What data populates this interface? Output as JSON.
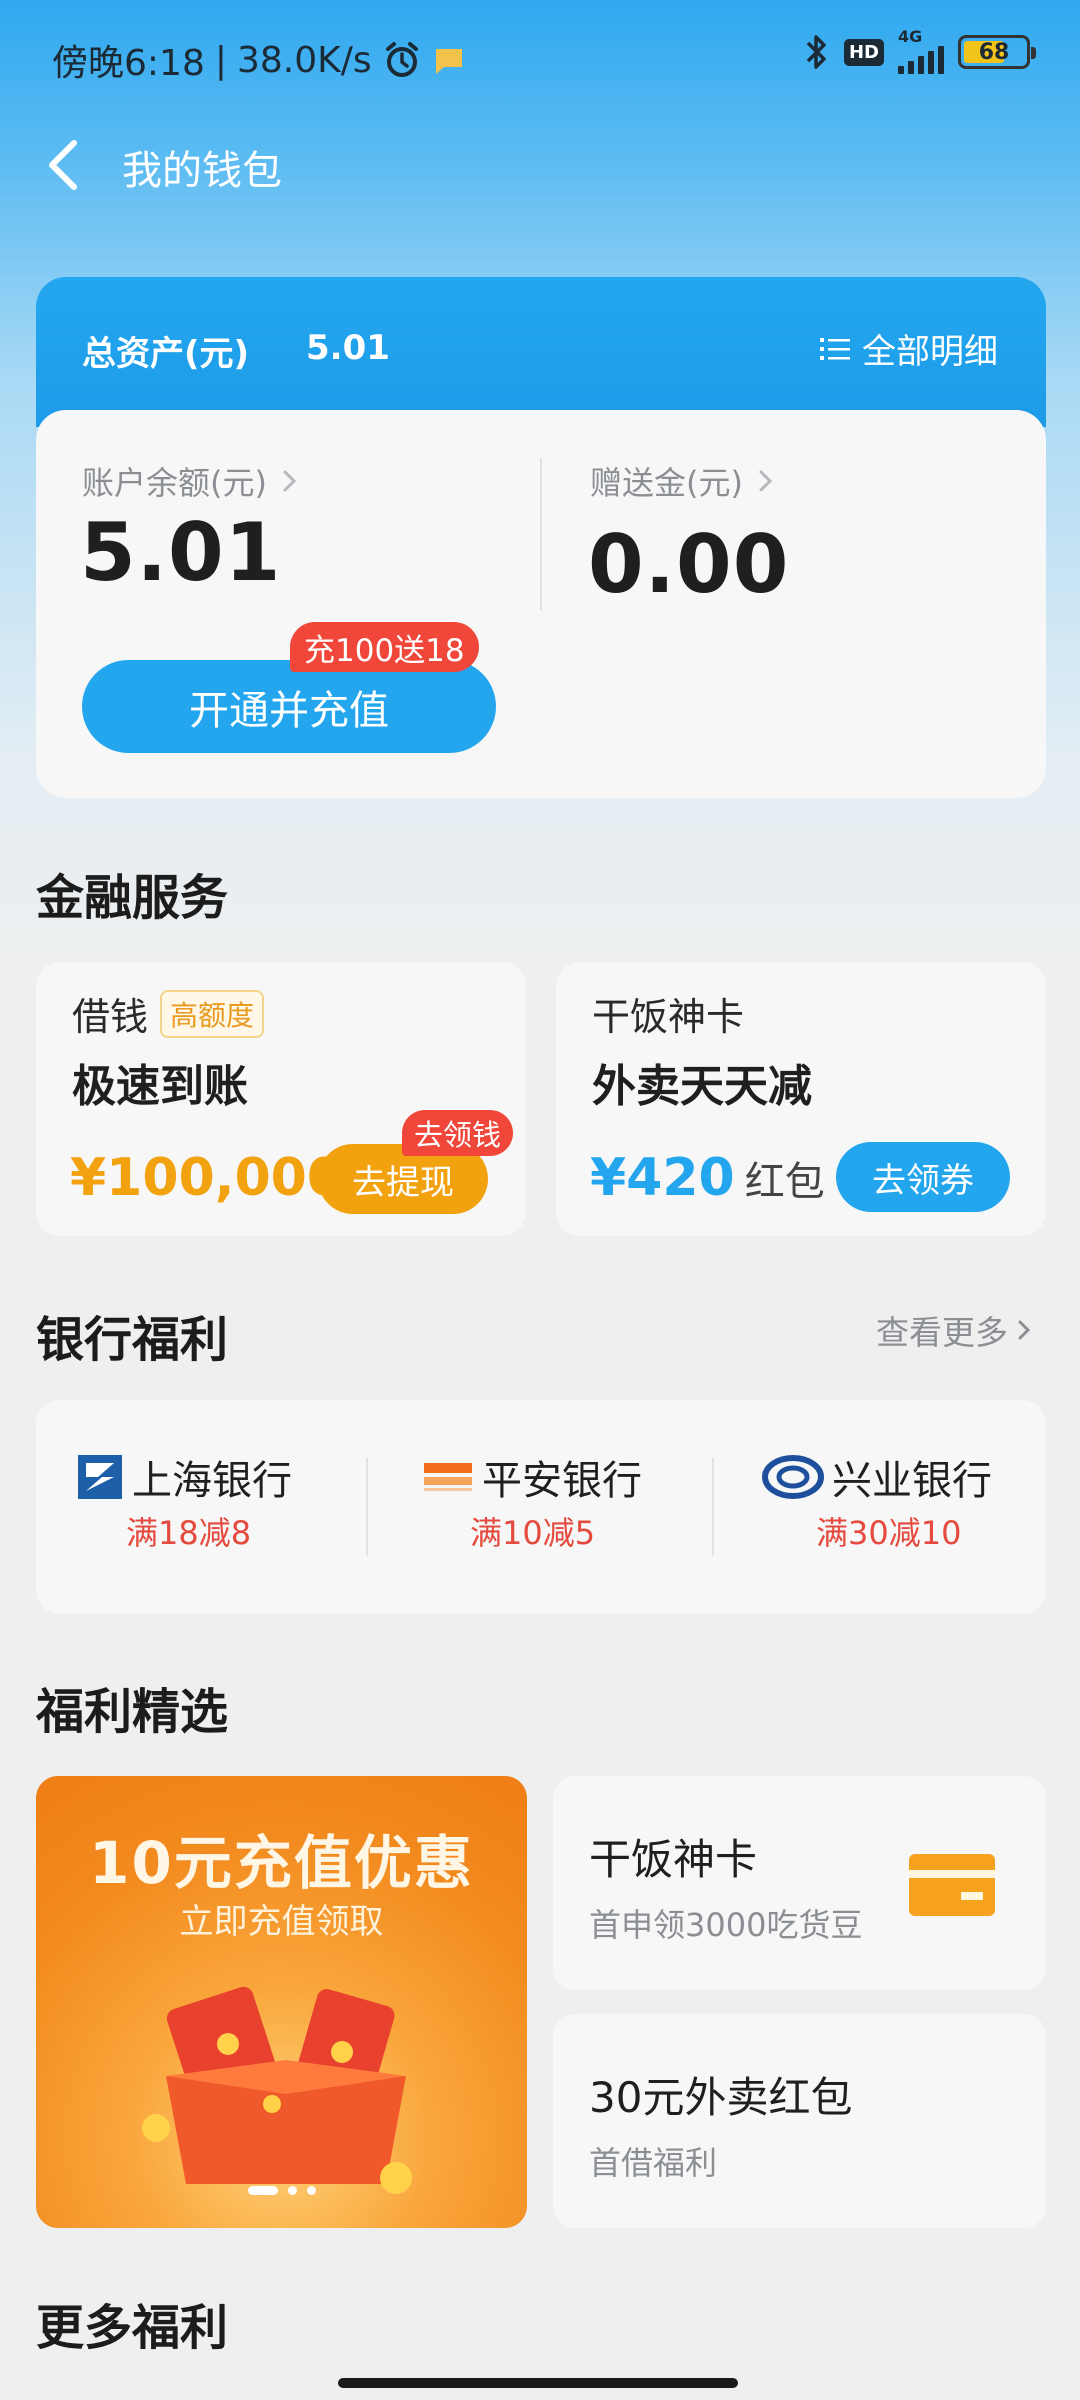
{
  "status_bar": {
    "time_text": "傍晚6:18",
    "net_speed": "38.0K/s",
    "network": "4G",
    "hd": "HD",
    "battery": "68"
  },
  "header": {
    "title": "我的钱包"
  },
  "assets": {
    "total_label": "总资产(元)",
    "total_value": "5.01",
    "detail_link": "全部明细",
    "balance_label": "账户余额(元)",
    "balance_value": "5.01",
    "bonus_label": "赠送金(元)",
    "bonus_value": "0.00",
    "recharge_button": "开通并充值",
    "recharge_badge": "充100送18"
  },
  "finance": {
    "section_title": "金融服务",
    "loan": {
      "sub": "借钱",
      "tag": "高额度",
      "title": "极速到账",
      "amount": "¥100,000",
      "button": "去提现",
      "badge": "去领钱"
    },
    "card": {
      "sub": "干饭神卡",
      "title": "外卖天天减",
      "amount": "¥420",
      "amount_unit": "红包",
      "button": "去领券"
    }
  },
  "bank": {
    "section_title": "银行福利",
    "more_link": "查看更多",
    "items": [
      {
        "name": "上海银行",
        "offer": "满18减8"
      },
      {
        "name": "平安银行",
        "offer": "满10减5"
      },
      {
        "name": "兴业银行",
        "offer": "满30减10"
      }
    ]
  },
  "welfare": {
    "section_title": "福利精选",
    "banner_title": "10元充值优惠",
    "banner_sub": "立即充值领取",
    "cards": [
      {
        "title": "干饭神卡",
        "sub": "首申领3000吃货豆"
      },
      {
        "title": "30元外卖红包",
        "sub": "首借福利"
      }
    ]
  },
  "more": {
    "section_title": "更多福利"
  },
  "colors": {
    "accent_blue": "#23a6ee",
    "orange": "#f2a20f",
    "red": "#f0473a"
  }
}
